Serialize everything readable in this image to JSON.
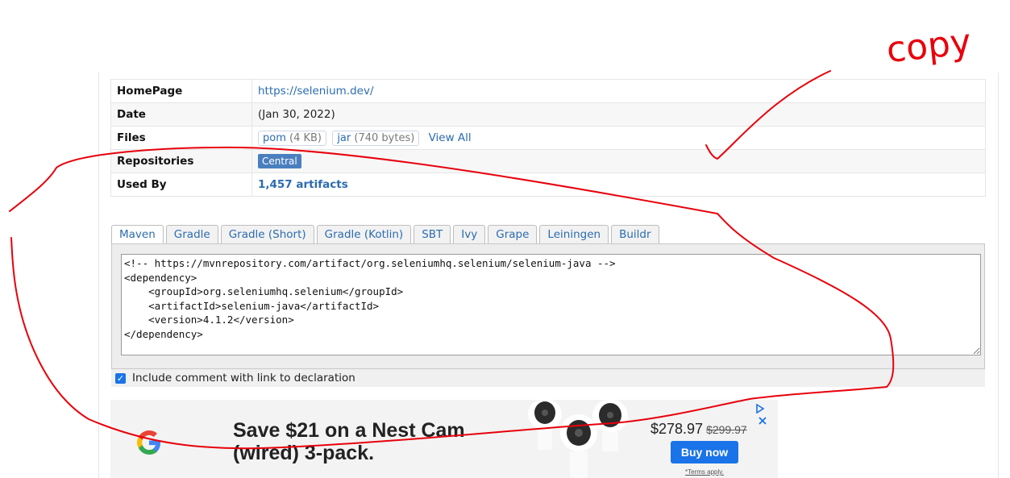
{
  "info": {
    "rows": [
      {
        "key": "HomePage",
        "value": "https://selenium.dev/"
      },
      {
        "key": "Date",
        "value": "(Jan 30, 2022)"
      },
      {
        "key": "Files",
        "files": [
          {
            "label": "pom",
            "size": "(4 KB)"
          },
          {
            "label": "jar",
            "size": "(740 bytes)"
          }
        ],
        "view_all": "View All"
      },
      {
        "key": "Repositories",
        "value": "Central"
      },
      {
        "key": "Used By",
        "value": "1,457 artifacts"
      }
    ]
  },
  "tabs": [
    "Maven",
    "Gradle",
    "Gradle (Short)",
    "Gradle (Kotlin)",
    "SBT",
    "Ivy",
    "Grape",
    "Leiningen",
    "Buildr"
  ],
  "code": "<!-- https://mvnrepository.com/artifact/org.seleniumhq.selenium/selenium-java -->\n<dependency>\n    <groupId>org.seleniumhq.selenium</groupId>\n    <artifactId>selenium-java</artifactId>\n    <version>4.1.2</version>\n</dependency>",
  "include_comment": {
    "label": "Include comment with link to declaration",
    "checked": true
  },
  "ad": {
    "headline": "Save $21 on a Nest Cam (wired) 3-pack.",
    "price": "$278.97",
    "old_price": "$299.97",
    "button": "Buy now",
    "terms": "*Terms apply.",
    "icons": [
      "adchoices-icon",
      "close-icon"
    ],
    "colors": {
      "button": "#1a73e8",
      "background": "#f3f3f3"
    }
  },
  "annotation": {
    "text": "copy",
    "color": "#e8000b"
  }
}
